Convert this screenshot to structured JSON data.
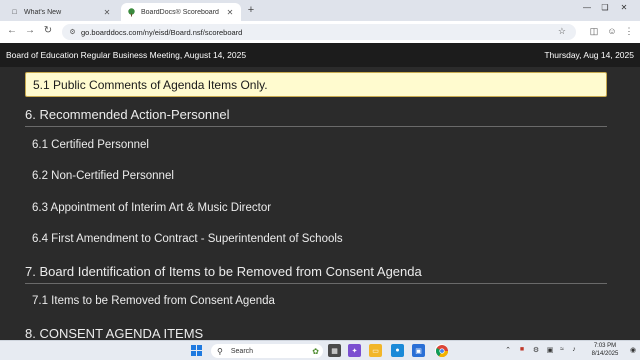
{
  "browser": {
    "tabs": [
      {
        "title": "What's New",
        "active": false
      },
      {
        "title": "BoardDocs® Scoreboard",
        "active": true
      }
    ],
    "url": "go.boarddocs.com/ny/eisd/Board.nsf/scoreboard"
  },
  "meeting": {
    "title": "Board of Education Regular Business Meeting, August 14, 2025",
    "date": "Thursday, Aug 14, 2025"
  },
  "current_item": "5.1 Public Comments of Agenda Items Only.",
  "agenda": [
    {
      "label": "6. Recommended Action-Personnel",
      "level": "section"
    },
    {
      "label": "6.1 Certified Personnel",
      "level": "sub"
    },
    {
      "label": "6.2 Non-Certified Personnel",
      "level": "sub"
    },
    {
      "label": "6.3 Appointment of Interim Art & Music Director",
      "level": "sub"
    },
    {
      "label": "6.4 First Amendment to Contract - Superintendent of Schools",
      "level": "sub"
    },
    {
      "label": "7. Board Identification of Items to be Removed from Consent Agenda",
      "level": "section"
    },
    {
      "label": "7.1 Items to be Removed from Consent Agenda",
      "level": "sub"
    },
    {
      "label": "8. CONSENT AGENDA ITEMS",
      "level": "section"
    }
  ],
  "taskbar": {
    "search_placeholder": "Search",
    "time": "7:03 PM",
    "date": "8/14/2025"
  },
  "colors": {
    "page_bg": "#2b2b2b",
    "header_bg": "#1c1c1c",
    "highlight_bg": "#fffbcf",
    "highlight_border": "#c7a94f"
  }
}
